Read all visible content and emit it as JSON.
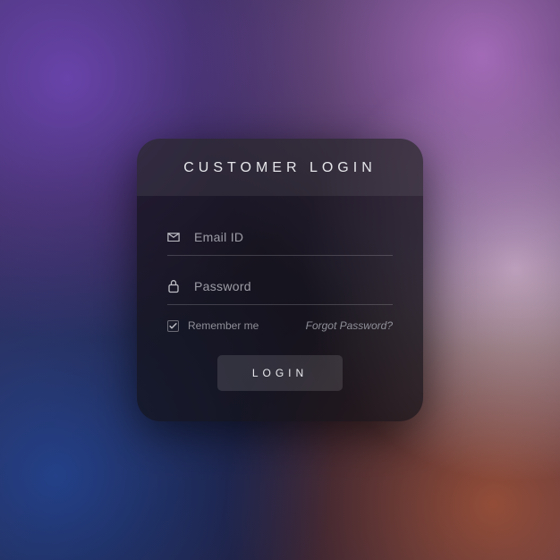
{
  "card": {
    "title": "CUSTOMER LOGIN",
    "email": {
      "placeholder": "Email ID",
      "value": ""
    },
    "password": {
      "placeholder": "Password",
      "value": ""
    },
    "remember": {
      "label": "Remember me",
      "checked": true
    },
    "forgot_label": "Forgot Password?",
    "submit_label": "LOGIN"
  }
}
